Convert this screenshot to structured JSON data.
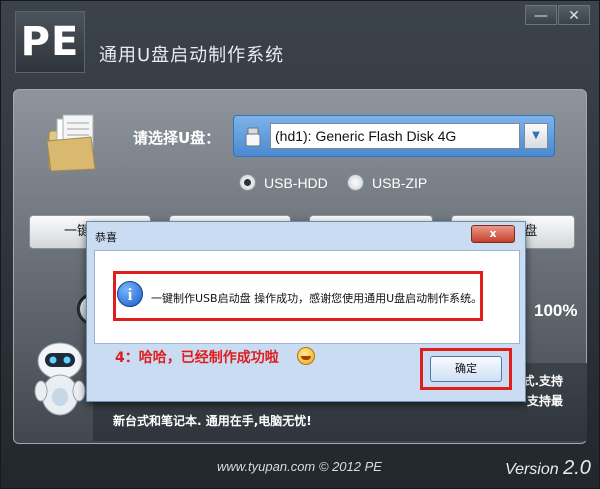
{
  "app": {
    "logo_text": "PE",
    "title": "通用U盘启动制作系统",
    "minimize_glyph": "—",
    "close_glyph": "✕"
  },
  "drive": {
    "label": "请选择U盘：",
    "selected": "(hd1): Generic Flash Disk 4G",
    "dropdown_icon": "chevron-down-icon"
  },
  "modes": [
    {
      "label": "USB-HDD",
      "selected": true
    },
    {
      "label": "USB-ZIP",
      "selected": false
    }
  ],
  "buttons": {
    "one_click": "一键制成",
    "b2": "",
    "b3": "",
    "b4": "启动U盘"
  },
  "progress": {
    "percent_text": "100%",
    "fraction": 1.0
  },
  "info": {
    "line1": "式.支持",
    "line2": "支持最",
    "line3": "新台式和笔记本. 通用在手,电脑无忧!"
  },
  "footer": {
    "url": "www.tyupan.com © 2012 PE",
    "version_label": "Version",
    "version_number": "2.0"
  },
  "dialog": {
    "title": "恭喜",
    "close_glyph": "x",
    "message": "一键制作USB启动盘 操作成功，感谢您使用通用U盘启动制作系统。",
    "info_glyph": "i",
    "note": "4：哈哈，已经制作成功啦",
    "ok_label": "确定"
  },
  "colors": {
    "accent_red": "#e01d1d",
    "dropdown_blue": "#4a8ad2",
    "window_dark": "#2b3036"
  }
}
